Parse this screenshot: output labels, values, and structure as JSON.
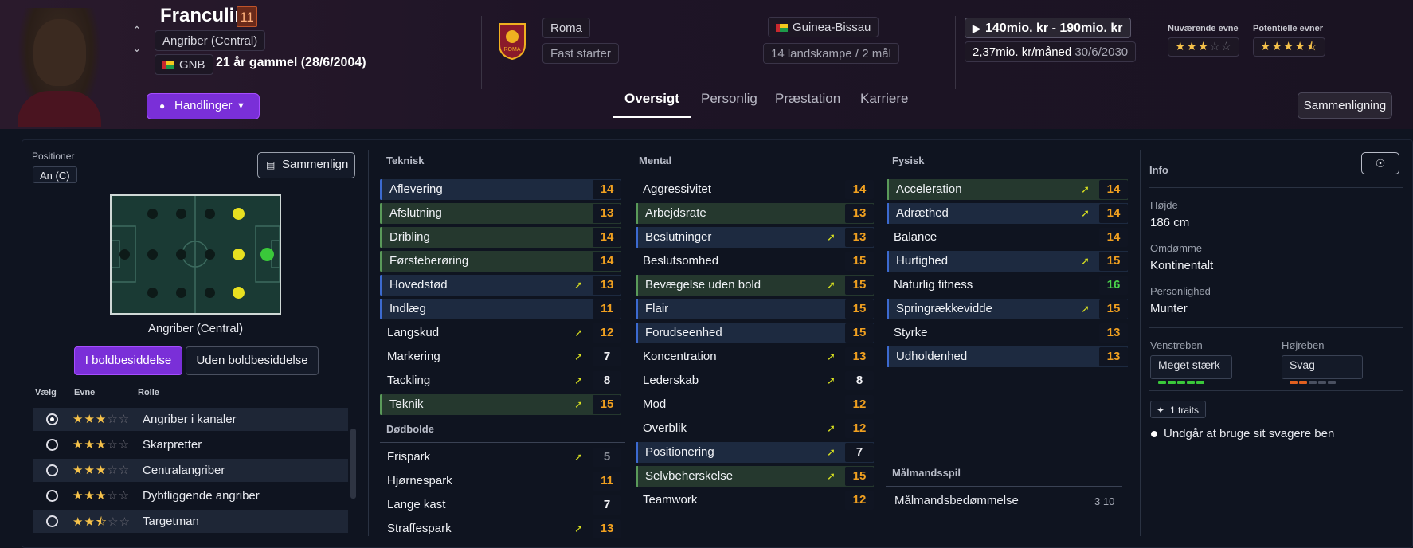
{
  "player": {
    "name": "Franculino",
    "number": "11",
    "position": "Angriber (Central)",
    "nation_code": "GNB",
    "age": "21 år gammel (28/6/2004)"
  },
  "header": {
    "club": "Roma",
    "role": "Fast starter",
    "nation": "Guinea-Bissau",
    "caps": "14 landskampe / 2 mål",
    "value": "140mio. kr - 190mio. kr",
    "wage": "2,37mio. kr/måned",
    "contract": "30/6/2030",
    "current_ability_label": "Nuværende evne",
    "potential_ability_label": "Potentielle evner",
    "current_ability_stars": 3,
    "potential_ability_stars": 4.5,
    "actions_label": "Handlinger",
    "compare_label": "Sammenligning"
  },
  "tabs": [
    {
      "label": "Oversigt"
    },
    {
      "label": "Personlig"
    },
    {
      "label": "Præstation"
    },
    {
      "label": "Karriere"
    }
  ],
  "positions": {
    "title": "Positioner",
    "badge": "An (C)",
    "compare_label": "Sammenlign",
    "pitch_caption": "Angriber (Central)",
    "toggle_on": "I boldbesiddelse",
    "toggle_off": "Uden boldbesiddelse",
    "col_choose": "Vælg",
    "col_ability": "Evne",
    "col_role": "Rolle",
    "roles": [
      {
        "name": "Angriber i kanaler",
        "stars": 3,
        "selected": true
      },
      {
        "name": "Skarpretter",
        "stars": 3,
        "selected": false
      },
      {
        "name": "Centralangriber",
        "stars": 3,
        "selected": false
      },
      {
        "name": "Dybtliggende angriber",
        "stars": 3,
        "selected": false
      },
      {
        "name": "Targetman",
        "stars": 2.5,
        "selected": false
      }
    ]
  },
  "technical": {
    "title": "Teknisk",
    "attrs": [
      {
        "name": "Aflevering",
        "value": "14",
        "arrow": false
      },
      {
        "name": "Afslutning",
        "value": "13",
        "arrow": false
      },
      {
        "name": "Dribling",
        "value": "14",
        "arrow": false
      },
      {
        "name": "Førsteberøring",
        "value": "14",
        "arrow": false
      },
      {
        "name": "Hovedstød",
        "value": "13",
        "arrow": true
      },
      {
        "name": "Indlæg",
        "value": "11",
        "arrow": false
      },
      {
        "name": "Langskud",
        "value": "12",
        "arrow": true
      },
      {
        "name": "Markering",
        "value": "7",
        "arrow": true
      },
      {
        "name": "Tackling",
        "value": "8",
        "arrow": true
      },
      {
        "name": "Teknik",
        "value": "15",
        "arrow": true
      }
    ]
  },
  "setpieces": {
    "title": "Dødbolde",
    "attrs": [
      {
        "name": "Frispark",
        "value": "5",
        "arrow": true
      },
      {
        "name": "Hjørnespark",
        "value": "11",
        "arrow": false
      },
      {
        "name": "Lange kast",
        "value": "7",
        "arrow": false
      },
      {
        "name": "Straffespark",
        "value": "13",
        "arrow": true
      }
    ]
  },
  "mental": {
    "title": "Mental",
    "attrs": [
      {
        "name": "Aggressivitet",
        "value": "14",
        "arrow": false
      },
      {
        "name": "Arbejdsrate",
        "value": "13",
        "arrow": false
      },
      {
        "name": "Beslutninger",
        "value": "13",
        "arrow": true
      },
      {
        "name": "Beslutsomhed",
        "value": "15",
        "arrow": false
      },
      {
        "name": "Bevægelse uden bold",
        "value": "15",
        "arrow": true
      },
      {
        "name": "Flair",
        "value": "15",
        "arrow": false
      },
      {
        "name": "Forudseenhed",
        "value": "15",
        "arrow": false
      },
      {
        "name": "Koncentration",
        "value": "13",
        "arrow": true
      },
      {
        "name": "Lederskab",
        "value": "8",
        "arrow": true
      },
      {
        "name": "Mod",
        "value": "12",
        "arrow": false
      },
      {
        "name": "Overblik",
        "value": "12",
        "arrow": true
      },
      {
        "name": "Positionering",
        "value": "7",
        "arrow": true
      },
      {
        "name": "Selvbeherskelse",
        "value": "15",
        "arrow": true
      },
      {
        "name": "Teamwork",
        "value": "12",
        "arrow": false
      }
    ]
  },
  "physical": {
    "title": "Fysisk",
    "attrs": [
      {
        "name": "Acceleration",
        "value": "14",
        "arrow": true
      },
      {
        "name": "Adræthed",
        "value": "14",
        "arrow": true
      },
      {
        "name": "Balance",
        "value": "14",
        "arrow": false
      },
      {
        "name": "Hurtighed",
        "value": "15",
        "arrow": true
      },
      {
        "name": "Naturlig fitness",
        "value": "16",
        "arrow": false
      },
      {
        "name": "Springrækkevidde",
        "value": "15",
        "arrow": true
      },
      {
        "name": "Styrke",
        "value": "13",
        "arrow": false
      },
      {
        "name": "Udholdenhed",
        "value": "13",
        "arrow": false
      }
    ]
  },
  "goalkeeping": {
    "title": "Målmandsspil",
    "label": "Målmandsbedømmelse",
    "value": "3 10"
  },
  "info": {
    "title": "Info",
    "height_label": "Højde",
    "height": "186 cm",
    "reputation_label": "Omdømme",
    "reputation": "Kontinentalt",
    "personality_label": "Personlighed",
    "personality": "Munter",
    "left_foot_label": "Venstreben",
    "left_foot": "Meget stærk",
    "left_foot_level": 5,
    "right_foot_label": "Højreben",
    "right_foot": "Svag",
    "right_foot_level": 2,
    "traits_label": "1 traits",
    "trait": "Undgår at bruge sit svagere ben"
  }
}
